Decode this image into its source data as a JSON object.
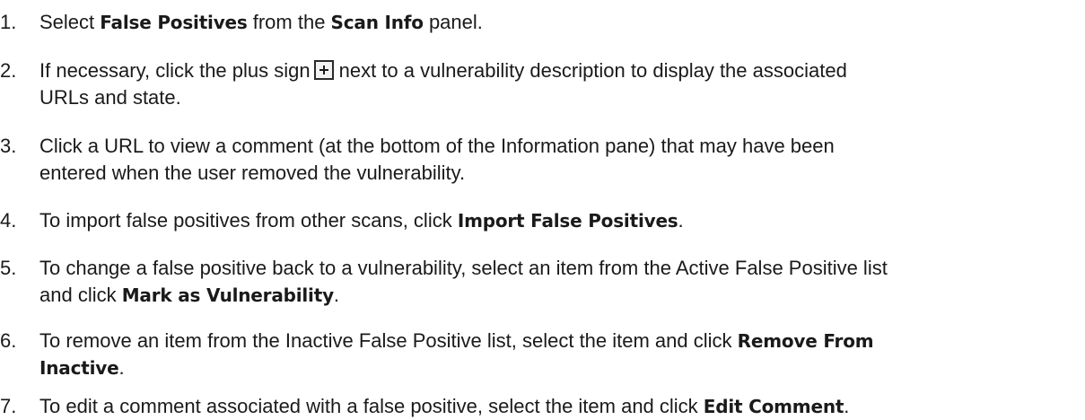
{
  "steps": [
    {
      "num": "1.",
      "parts": [
        "Select ",
        "False Positives",
        " from the ",
        "Scan Info",
        " panel."
      ]
    },
    {
      "num": "2.",
      "line1_before_icon": "If necessary, click the plus sign",
      "icon": "plus-box-icon",
      "line1_after_icon": "next to a vulnerability description to display the associated",
      "line2": "URLs and state."
    },
    {
      "num": "3.",
      "line1": "Click a URL to view a comment (at the bottom of the Information pane) that may have been",
      "line2": "entered when the user removed the vulnerability."
    },
    {
      "num": "4.",
      "parts": [
        "To import false positives from other scans, click ",
        "Import False Positives",
        "."
      ]
    },
    {
      "num": "5.",
      "line1": "To change a false positive back to a vulnerability, select an item from the Active False Positive list",
      "line2_parts": [
        "and click ",
        "Mark as Vulnerability",
        "."
      ]
    },
    {
      "num": "6.",
      "line1_text": "To remove an item from the Inactive False Positive list, select the item and click ",
      "line1_bold": "Remove From",
      "line2_bold": "Inactive",
      "line2_end": "."
    },
    {
      "num": "7.",
      "parts": [
        "To edit a comment associated with a false positive, select the item and click ",
        "Edit Comment",
        "."
      ]
    }
  ]
}
